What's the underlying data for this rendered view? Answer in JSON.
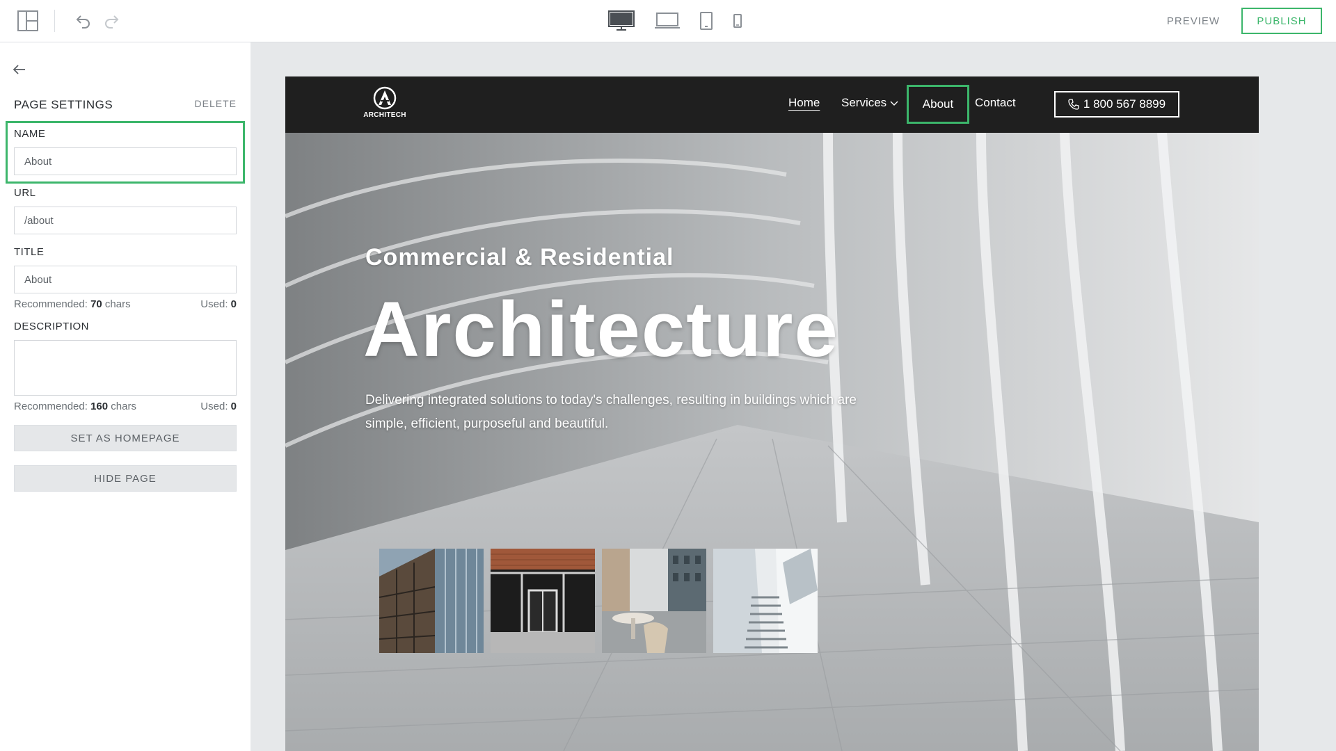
{
  "toolbar": {
    "layout_icon": "layout-panel-icon",
    "undo_icon": "undo-icon",
    "redo_icon": "redo-icon",
    "devices": [
      "desktop-icon",
      "laptop-icon",
      "tablet-icon",
      "mobile-icon"
    ],
    "preview_label": "PREVIEW",
    "publish_label": "PUBLISH",
    "accent_color": "#3cb66b"
  },
  "panel": {
    "title": "PAGE SETTINGS",
    "delete_label": "DELETE",
    "name": {
      "label": "NAME",
      "value": "About"
    },
    "url": {
      "label": "URL",
      "value": "/about"
    },
    "page_title": {
      "label": "TITLE",
      "value": "About"
    },
    "title_hint": {
      "recommended_prefix": "Recommended:",
      "recommended_value": "70",
      "recommended_suffix": "chars",
      "used_prefix": "Used:",
      "used_value": "0"
    },
    "description": {
      "label": "DESCRIPTION",
      "value": ""
    },
    "description_hint": {
      "recommended_prefix": "Recommended:",
      "recommended_value": "160",
      "recommended_suffix": "chars",
      "used_prefix": "Used:",
      "used_value": "0"
    },
    "homepage_button": "SET AS HOMEPAGE",
    "hide_button": "HIDE PAGE"
  },
  "site": {
    "logo_text": "ARCHITECH",
    "nav": {
      "home": "Home",
      "services": "Services",
      "about": "About",
      "contact": "Contact",
      "phone": "1 800 567 8899"
    },
    "hero": {
      "subtitle": "Commercial & Residential",
      "title": "Architecture",
      "description": "Delivering integrated solutions to today's challenges, resulting in buildings which are simple, efficient, purposeful and beautiful."
    },
    "thumbnails": [
      "glass-tower-photo",
      "brick-storefront-photo",
      "courtyard-cafe-photo",
      "white-staircase-photo"
    ]
  }
}
